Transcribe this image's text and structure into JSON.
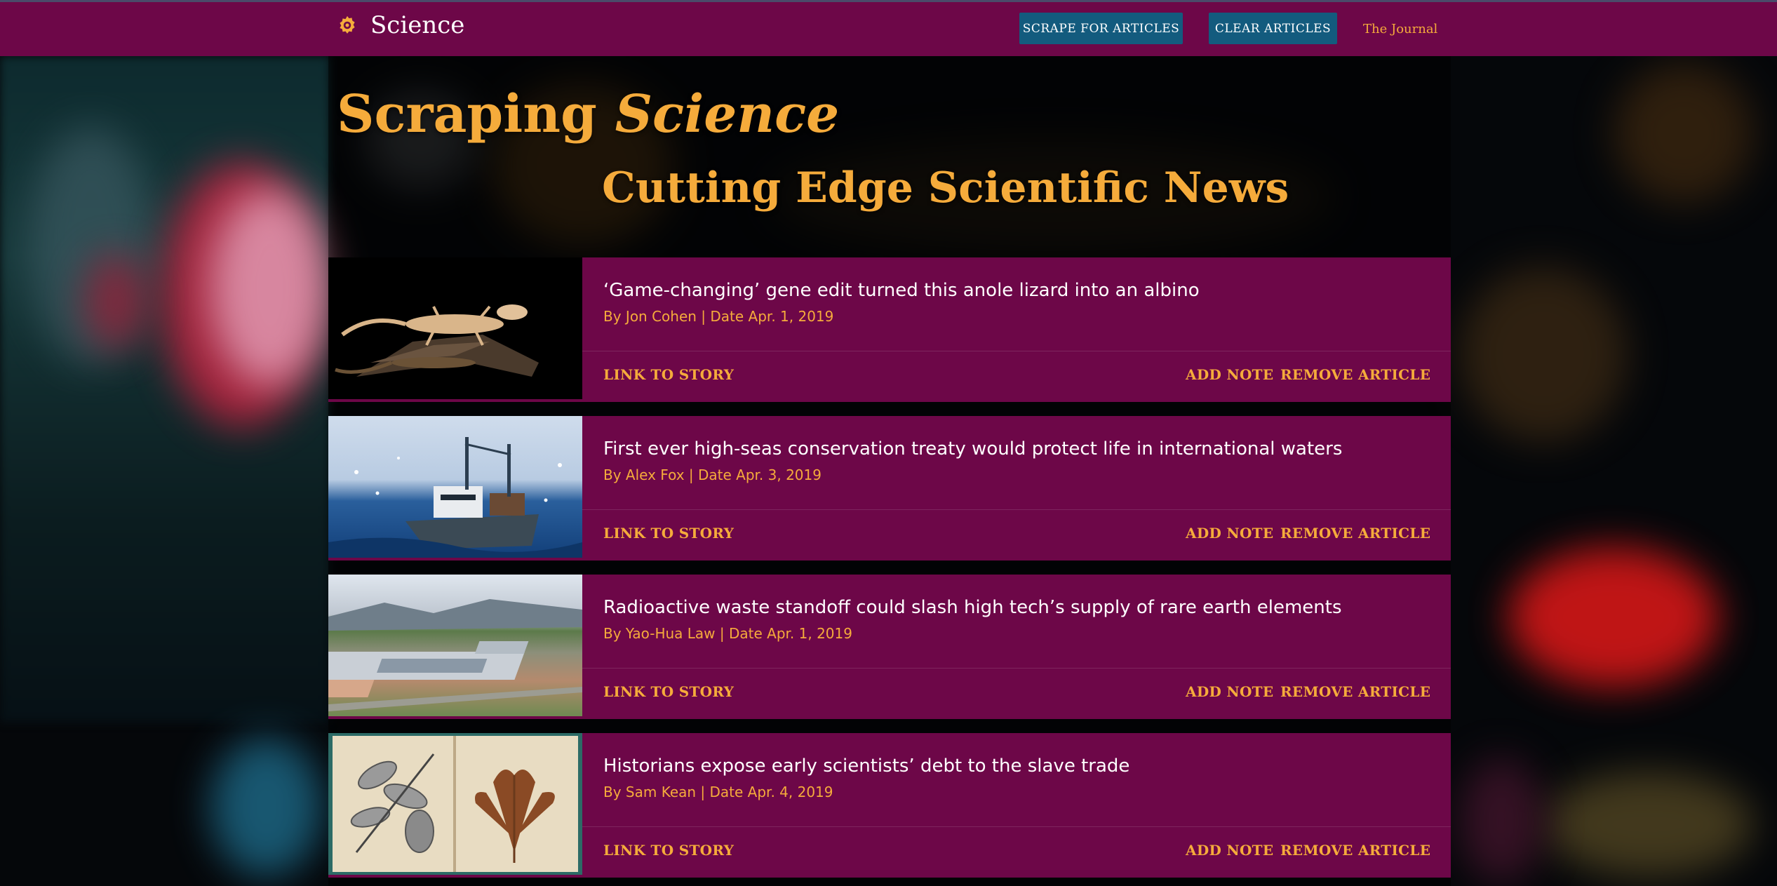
{
  "navbar": {
    "brand": "Science",
    "brand_icon": "gear-icon",
    "scrape_button": "SCRAPE FOR ARTICLES",
    "clear_button": "CLEAR ARTICLES",
    "journal_link": "The Journal"
  },
  "hero": {
    "title_prefix": "Scraping",
    "title_emphasis": "Science",
    "subtitle": "Cutting Edge Scientific News"
  },
  "articles": [
    {
      "title": "‘Game-changing’ gene edit turned this anole lizard into an albino",
      "meta": "By Jon Cohen | Date Apr. 1, 2019",
      "image": "albino-lizard-image"
    },
    {
      "title": "First ever high-seas conservation treaty would protect life in international waters",
      "meta": "By Alex Fox | Date Apr. 3, 2019",
      "image": "fishing-ship-image"
    },
    {
      "title": "Radioactive waste standoff could slash high tech’s supply of rare earth elements",
      "meta": "By Yao-Hua Law | Date Apr. 1, 2019",
      "image": "industrial-plant-image"
    },
    {
      "title": "Historians expose early scientists’ debt to the slave trade",
      "meta": "By Sam Kean | Date Apr. 4, 2019",
      "image": "herbarium-book-image"
    }
  ],
  "card_actions": {
    "link": "LINK TO STORY",
    "note": "ADD NOTE",
    "remove": "REMOVE ARTICLE"
  },
  "colors": {
    "navbar": "#6d0748",
    "card": "#6d0748",
    "accent": "#f5ab3b",
    "button": "#135b7e"
  }
}
